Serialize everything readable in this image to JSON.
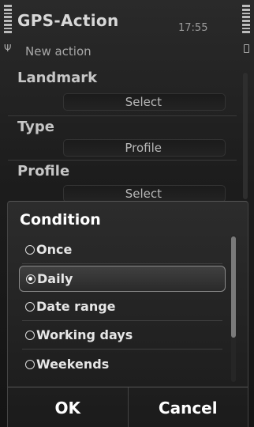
{
  "status": {
    "app_title": "GPS-Action",
    "clock": "17:55",
    "subtitle": "New action"
  },
  "form": {
    "fields": [
      {
        "label": "Landmark",
        "value": "Select"
      },
      {
        "label": "Type",
        "value": "Profile"
      },
      {
        "label": "Profile",
        "value": "Select"
      }
    ]
  },
  "dialog": {
    "title": "Condition",
    "options": [
      {
        "label": "Once",
        "selected": false
      },
      {
        "label": "Daily",
        "selected": true
      },
      {
        "label": "Date range",
        "selected": false
      },
      {
        "label": "Working days",
        "selected": false
      },
      {
        "label": "Weekends",
        "selected": false
      }
    ],
    "ok_label": "OK",
    "cancel_label": "Cancel"
  },
  "icons": {
    "signal": "signal-strength-icon",
    "battery": "battery-icon",
    "antenna": "antenna-icon",
    "radio_off": "radio-unselected-icon",
    "radio_on": "radio-selected-icon"
  },
  "colors": {
    "background": "#1d1d1d",
    "dialog_background": "#242424",
    "text_primary": "#ffffff",
    "selection_border": "#8a8a8a"
  }
}
